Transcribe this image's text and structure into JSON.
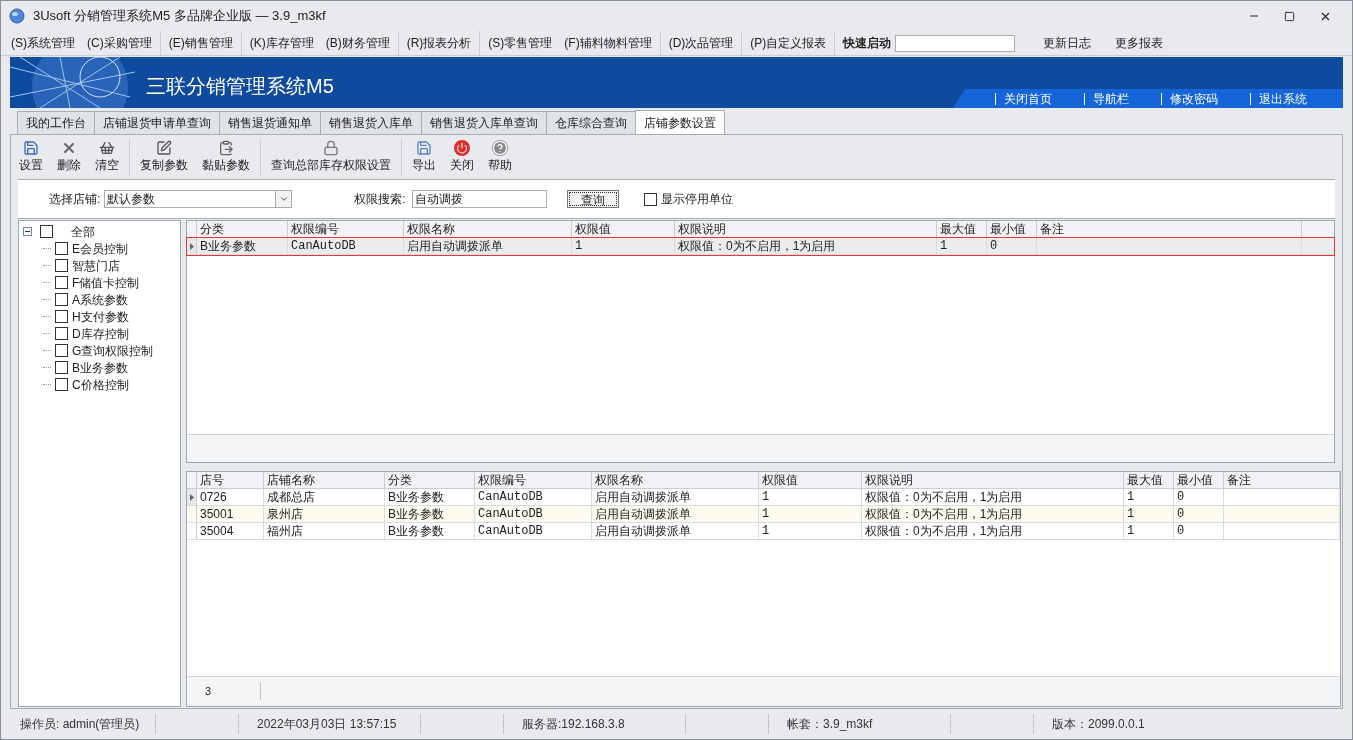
{
  "window": {
    "title": "3Usoft 分销管理系统M5 多品牌企业版 — 3.9_m3kf"
  },
  "menu": {
    "groups": [
      [
        "(S)系统管理",
        "(C)采购管理"
      ],
      [
        "(E)销售管理"
      ],
      [
        "(K)库存管理",
        "(B)财务管理"
      ],
      [
        "(R)报表分析"
      ],
      [
        "(S)零售管理",
        "(F)辅料物料管理"
      ],
      [
        "(D)次品管理"
      ],
      [
        "(P)自定义报表"
      ]
    ],
    "quick_launch_label": "快速启动",
    "links": [
      "更新日志",
      "更多报表"
    ]
  },
  "banner": {
    "title": "三联分销管理系统M5",
    "links": [
      "关闭首页",
      "导航栏",
      "修改密码",
      "退出系统"
    ]
  },
  "tabs": [
    {
      "label": "我的工作台",
      "selected": false
    },
    {
      "label": "店铺退货申请单查询",
      "selected": false
    },
    {
      "label": "销售退货通知单",
      "selected": false
    },
    {
      "label": "销售退货入库单",
      "selected": false
    },
    {
      "label": "销售退货入库单查询",
      "selected": false
    },
    {
      "label": "仓库综合查询",
      "selected": false
    },
    {
      "label": "店铺参数设置",
      "selected": true
    }
  ],
  "toolbar": [
    [
      {
        "label": "设置",
        "kind": "save"
      },
      {
        "label": "删除",
        "kind": "delete"
      },
      {
        "label": "清空",
        "kind": "clear"
      }
    ],
    [
      {
        "label": "复制参数",
        "kind": "copy"
      },
      {
        "label": "黏贴参数",
        "kind": "paste"
      }
    ],
    [
      {
        "label": "查询总部库存权限设置",
        "kind": "lock"
      }
    ],
    [
      {
        "label": "导出",
        "kind": "export"
      },
      {
        "label": "关闭",
        "kind": "close"
      },
      {
        "label": "帮助",
        "kind": "help"
      }
    ]
  ],
  "filter": {
    "store_label": "选择店铺:",
    "store_value": "默认参数",
    "search_label": "权限搜索:",
    "search_value": "自动调拨",
    "query_button": "查询",
    "show_disabled": {
      "label": "显示停用单位",
      "checked": false
    }
  },
  "tree": {
    "label": "全部",
    "checked": false,
    "expanded": true,
    "children": [
      {
        "label": "E会员控制",
        "checked": false
      },
      {
        "label": "智慧门店",
        "checked": false
      },
      {
        "label": "F储值卡控制",
        "checked": false
      },
      {
        "label": "A系统参数",
        "checked": false
      },
      {
        "label": "H支付参数",
        "checked": false
      },
      {
        "label": "D库存控制",
        "checked": false
      },
      {
        "label": "G查询权限控制",
        "checked": false
      },
      {
        "label": "B业务参数",
        "checked": false
      },
      {
        "label": "C价格控制",
        "checked": false
      }
    ]
  },
  "top_grid": {
    "columns": [
      "分类",
      "权限编号",
      "权限名称",
      "权限值",
      "权限说明",
      "最大值",
      "最小值",
      "备注"
    ],
    "rows": [
      {
        "selected": true,
        "highlighted": true,
        "cells": [
          "B业务参数",
          "CanAutoDB",
          "启用自动调拨派单",
          "1",
          "权限值：0为不启用，1为启用",
          "1",
          "0",
          ""
        ]
      }
    ]
  },
  "bottom_grid": {
    "columns": [
      "店号",
      "店铺名称",
      "分类",
      "权限编号",
      "权限名称",
      "权限值",
      "权限说明",
      "最大值",
      "最小值",
      "备注"
    ],
    "rows": [
      {
        "selected": true,
        "cells": [
          "0726",
          "成都总店",
          "B业务参数",
          "CanAutoDB",
          "启用自动调拨派单",
          "1",
          "权限值：0为不启用，1为启用",
          "1",
          "0",
          ""
        ]
      },
      {
        "selected": false,
        "cells": [
          "35001",
          "泉州店",
          "B业务参数",
          "CanAutoDB",
          "启用自动调拨派单",
          "1",
          "权限值：0为不启用，1为启用",
          "1",
          "0",
          ""
        ]
      },
      {
        "selected": false,
        "cells": [
          "35004",
          "福州店",
          "B业务参数",
          "CanAutoDB",
          "启用自动调拨派单",
          "1",
          "权限值：0为不启用，1为启用",
          "1",
          "0",
          ""
        ]
      }
    ],
    "footer_count": "3"
  },
  "status_bar": [
    "操作员: admin(管理员)",
    "2022年03月03日 13:57:15",
    "服务器:192.168.3.8",
    "帐套：3.9_m3kf",
    "版本：2099.0.0.1"
  ]
}
